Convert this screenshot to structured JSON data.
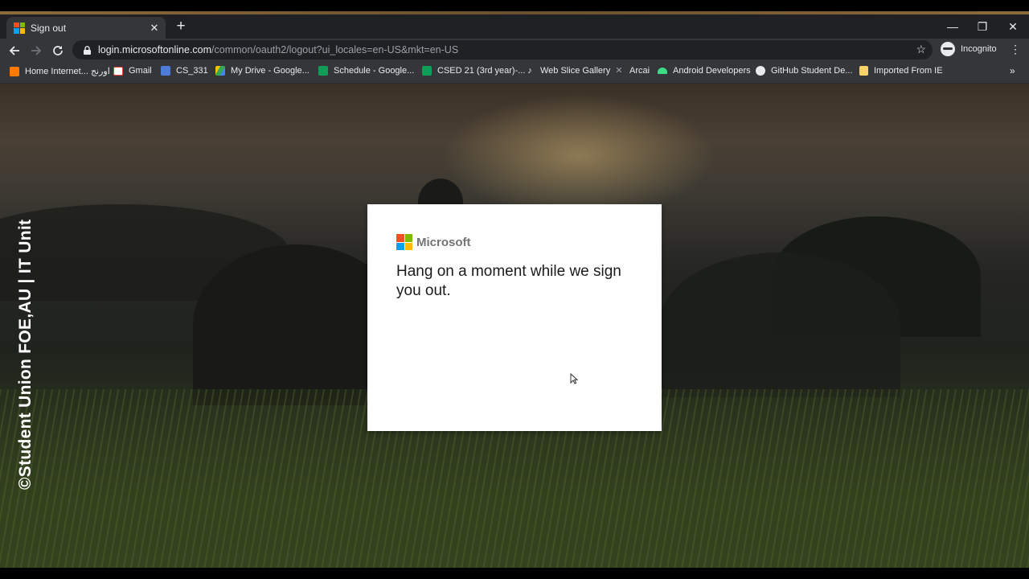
{
  "browser": {
    "tab": {
      "title": "Sign out",
      "close_glyph": "✕"
    },
    "new_tab_glyph": "+",
    "window_controls": {
      "minimize": "—",
      "maximize": "❐",
      "close": "✕"
    },
    "omnibox": {
      "host": "login.microsoftonline.com",
      "path": "/common/oauth2/logout?ui_locales=en-US&mkt=en-US"
    },
    "profile_label": "Incognito",
    "menu_glyph": "⋮",
    "bookmarks_more_glyph": "»",
    "bookmarks": [
      {
        "label": "Home Internet... اورنج",
        "icon": "orange-square-icon",
        "color": "#ff7900"
      },
      {
        "label": "Gmail",
        "icon": "gmail-icon",
        "color": "#ea4335"
      },
      {
        "label": "CS_331",
        "icon": "p-icon",
        "color": "#4c7bd9"
      },
      {
        "label": "My Drive - Google...",
        "icon": "google-drive-icon",
        "color": "#34a853"
      },
      {
        "label": "Schedule - Google...",
        "icon": "google-sheets-icon",
        "color": "#0f9d58"
      },
      {
        "label": "CSED 21 (3rd year)-...",
        "icon": "google-sheets-icon",
        "color": "#0f9d58"
      },
      {
        "label": "Web Slice Gallery",
        "icon": "web-slice-icon",
        "color": "#e8eaed"
      },
      {
        "label": "Arcai",
        "icon": "arcai-icon",
        "color": "#9aa0a6"
      },
      {
        "label": "Android Developers",
        "icon": "android-icon",
        "color": "#3ddc84"
      },
      {
        "label": "GitHub Student De...",
        "icon": "github-icon",
        "color": "#e8eaed"
      },
      {
        "label": "Imported From IE",
        "icon": "folder-icon",
        "color": "#f9d26a"
      }
    ]
  },
  "watermark": "©Student Union FOE,AU | IT Unit",
  "dialog": {
    "brand": "Microsoft",
    "heading": "Hang on a moment while we sign you out."
  },
  "colors": {
    "ms_red": "#f25022",
    "ms_green": "#7fba00",
    "ms_blue": "#00a4ef",
    "ms_yellow": "#ffb900"
  }
}
